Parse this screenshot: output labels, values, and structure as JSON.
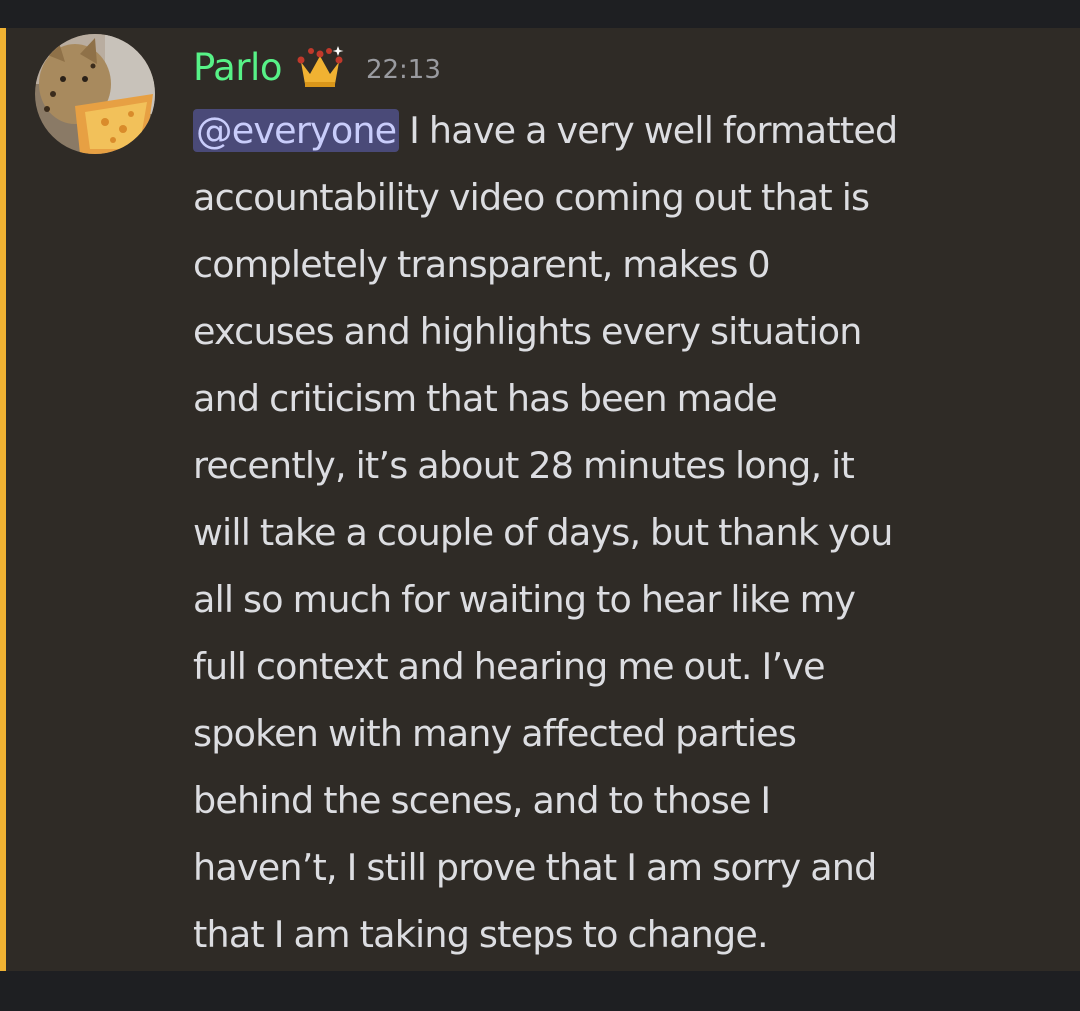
{
  "message": {
    "author": "Parlo",
    "timestamp": "22:13",
    "author_color": "#57f287",
    "mention_stripe_color": "#f0b232",
    "badge_icon": "crown-icon",
    "mention": "@everyone",
    "lines": [
      " I have a very well formatted",
      "accountability video coming out that is",
      "completely transparent, makes 0",
      "excuses and highlights every situation",
      "and criticism that has been made",
      "recently, it’s about 28 minutes long, it",
      "will take a couple of days, but thank you",
      "all so much for waiting to hear like my",
      "full context and hearing me out. I’ve",
      "spoken with many affected parties",
      "behind the scenes, and to those I",
      "haven’t, I still prove that I am sorry and",
      "that I am taking steps to change."
    ]
  }
}
